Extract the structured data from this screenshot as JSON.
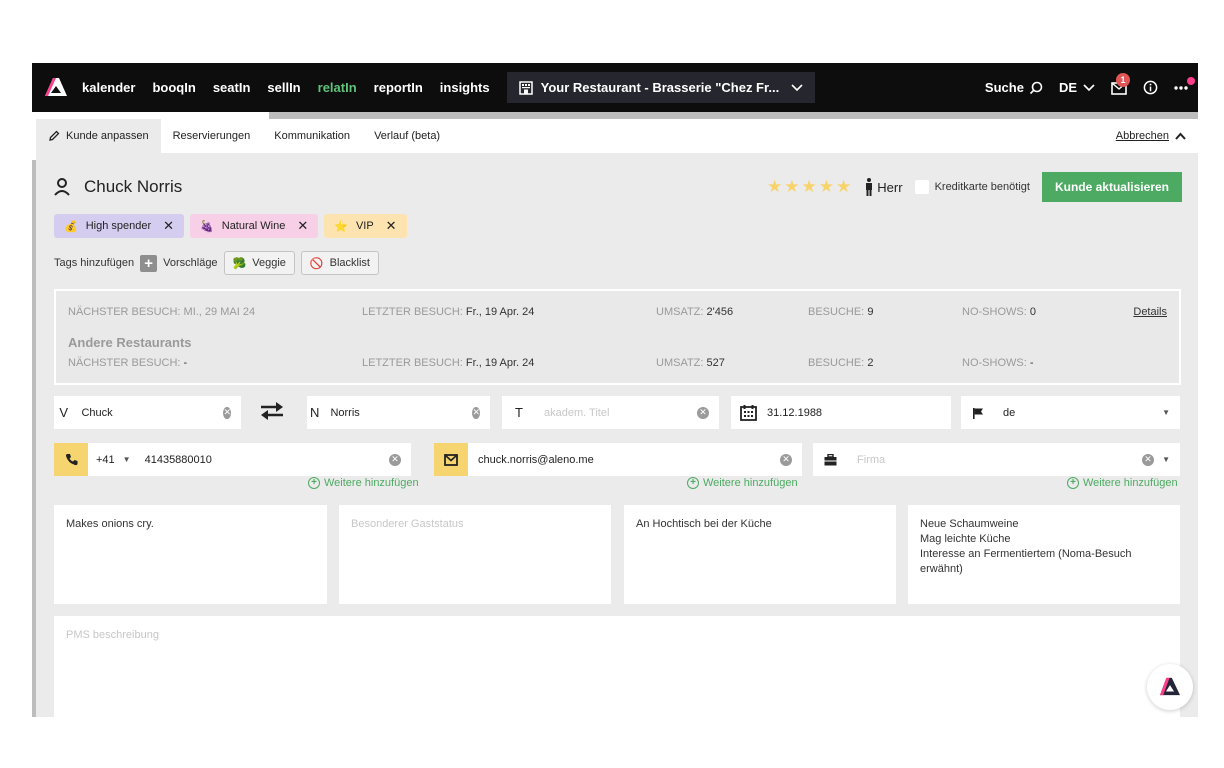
{
  "nav": {
    "items": [
      {
        "label": "kalender",
        "active": false
      },
      {
        "label": "booqIn",
        "active": false
      },
      {
        "label": "seatIn",
        "active": false
      },
      {
        "label": "sellIn",
        "active": false
      },
      {
        "label": "relatIn",
        "active": true
      },
      {
        "label": "reportIn",
        "active": false
      },
      {
        "label": "insights",
        "active": false
      }
    ],
    "restaurant": "Your Restaurant - Brasserie \"Chez Fr...",
    "search_label": "Suche",
    "language": "DE",
    "mail_badge": "1",
    "active_color": "#5ec27a"
  },
  "tabs": {
    "items": [
      "Kunde anpassen",
      "Reservierungen",
      "Kommunikation",
      "Verlauf (beta)"
    ],
    "cancel": "Abbrechen"
  },
  "customer": {
    "name": "Chuck Norris",
    "rating": 5,
    "salutation": "Herr",
    "credit_card_label": "Kreditkarte benötigt",
    "credit_card_required": false,
    "update_button": "Kunde aktualisieren"
  },
  "tags": [
    {
      "emoji": "💰",
      "label": "High spender",
      "color": "#d5cdf0"
    },
    {
      "emoji": "🍇",
      "label": "Natural Wine",
      "color": "#f7cfe6"
    },
    {
      "emoji": "⭐",
      "label": "VIP",
      "color": "#fde3b0"
    }
  ],
  "add_tags": {
    "label": "Tags hinzufügen",
    "suggestions_label": "Vorschläge",
    "suggestions": [
      {
        "emoji": "🥦",
        "label": "Veggie"
      },
      {
        "emoji": "🚫",
        "label": "Blacklist"
      }
    ]
  },
  "stats": {
    "this_restaurant": {
      "next_visit_label": "NÄCHSTER BESUCH:",
      "next_visit": "MI., 29 MAI 24",
      "last_visit_label": "LETZTER BESUCH:",
      "last_visit": "Fr., 19 Apr. 24",
      "revenue_label": "UMSATZ:",
      "revenue": "2'456",
      "visits_label": "BESUCHE:",
      "visits": "9",
      "noshows_label": "NO-SHOWS:",
      "noshows": "0"
    },
    "other_title": "Andere Restaurants",
    "other": {
      "next_visit_label": "NÄCHSTER BESUCH:",
      "next_visit": "-",
      "last_visit_label": "LETZTER BESUCH:",
      "last_visit": "Fr., 19 Apr. 24",
      "revenue_label": "UMSATZ:",
      "revenue": "527",
      "visits_label": "BESUCHE:",
      "visits": "2",
      "noshows_label": "NO-SHOWS:",
      "noshows": "-"
    },
    "details_link": "Details"
  },
  "fields": {
    "firstname": {
      "prefix": "V",
      "value": "Chuck"
    },
    "lastname": {
      "prefix": "N",
      "value": "Norris"
    },
    "title": {
      "prefix": "T",
      "placeholder": "akadem. Titel"
    },
    "birthday": {
      "value": "31.12.1988"
    },
    "language": {
      "value": "de"
    },
    "phone": {
      "country_code": "+41",
      "value": "41435880010"
    },
    "email": {
      "value": "chuck.norris@aleno.me"
    },
    "company": {
      "placeholder": "Firma"
    },
    "add_more": "Weitere hinzufügen"
  },
  "notes": [
    {
      "text": "Makes onions cry.",
      "placeholder": false
    },
    {
      "text": "Besonderer Gaststatus",
      "placeholder": true
    },
    {
      "text": "An Hochtisch bei der Küche",
      "placeholder": false
    },
    {
      "text": "Neue Schaumweine\nMag leichte Küche\nInteresse an Fermentiertem (Noma-Besuch erwähnt)",
      "placeholder": false
    }
  ],
  "pms": {
    "placeholder": "PMS beschreibung"
  },
  "colors": {
    "primary_green": "#4caa62",
    "accent_yellow": "#f6d46f",
    "brand_pink": "#ff3d8b"
  }
}
